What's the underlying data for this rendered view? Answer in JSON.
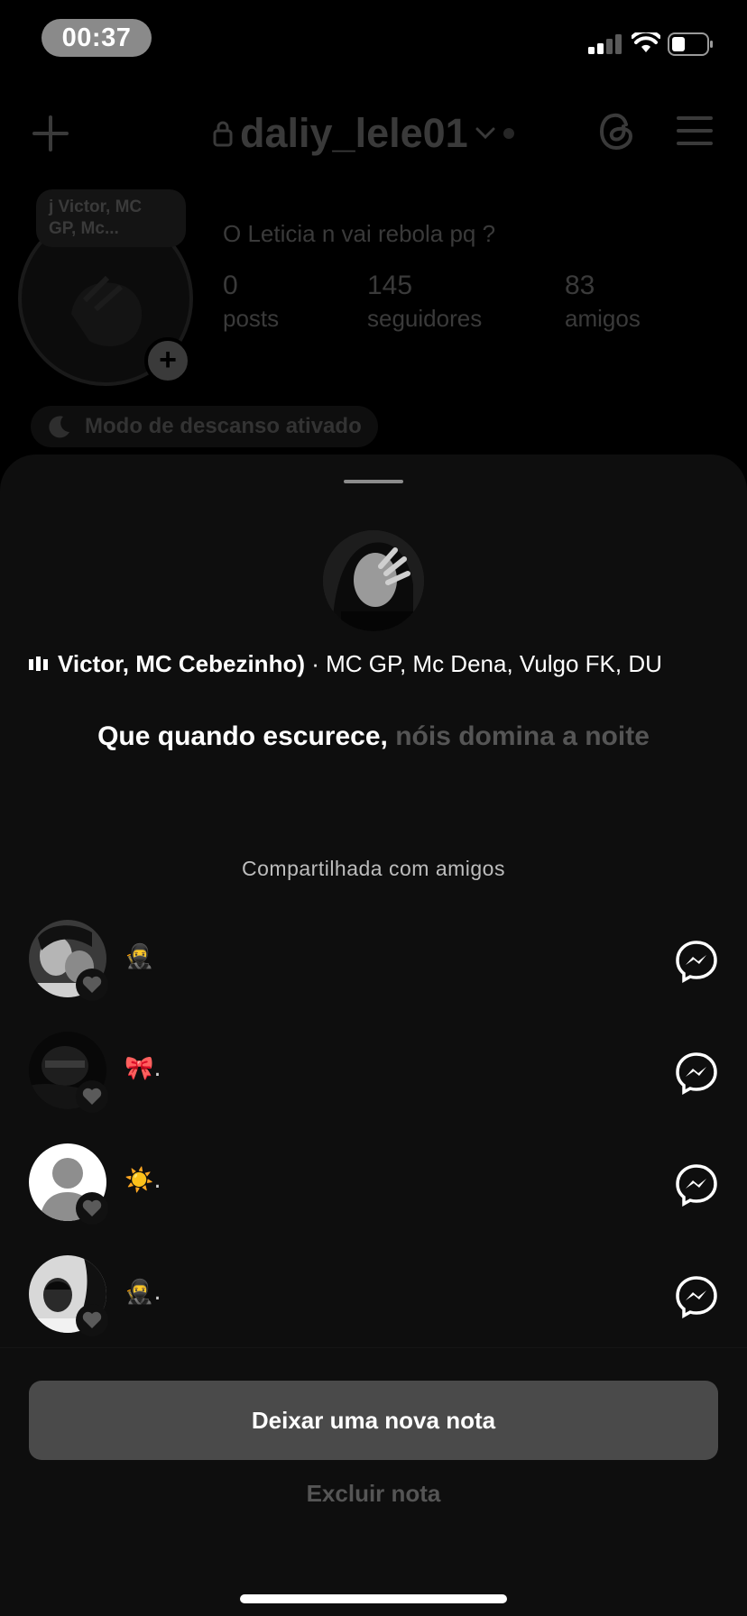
{
  "status_bar": {
    "time": "00:37",
    "icons": [
      "cellular-signal-icon",
      "wifi-icon",
      "battery-icon"
    ]
  },
  "profile": {
    "username": "daliy_lele01",
    "note_preview": "j Victor, MC GP, Mc...",
    "bio": "O Leticia n vai rebola pq ?",
    "stats": [
      {
        "value": "0",
        "label": "posts"
      },
      {
        "value": "145",
        "label": "seguidores"
      },
      {
        "value": "83",
        "label": "amigos"
      }
    ],
    "rest_mode": "Modo de descanso ativado"
  },
  "sheet": {
    "music": {
      "bold_part": "Victor, MC Cebezinho)",
      "rest": " · MC GP, Mc Dena, Vulgo FK, DU"
    },
    "lyric": {
      "sung": "Que quando escurece,",
      "upcoming": "nóis domina a noite"
    },
    "shared_label": "Compartilhada com amigos",
    "friends": [
      {
        "reaction": "🥷"
      },
      {
        "reaction": "🎀."
      },
      {
        "reaction": "☀️."
      },
      {
        "reaction": "🥷."
      }
    ],
    "primary_button": "Deixar uma nova nota",
    "secondary_button": "Excluir nota"
  },
  "colors": {
    "background": "#000000",
    "sheet": "#0e0e0e",
    "primary_button": "#4a4a4a",
    "muted_text": "#555555"
  }
}
